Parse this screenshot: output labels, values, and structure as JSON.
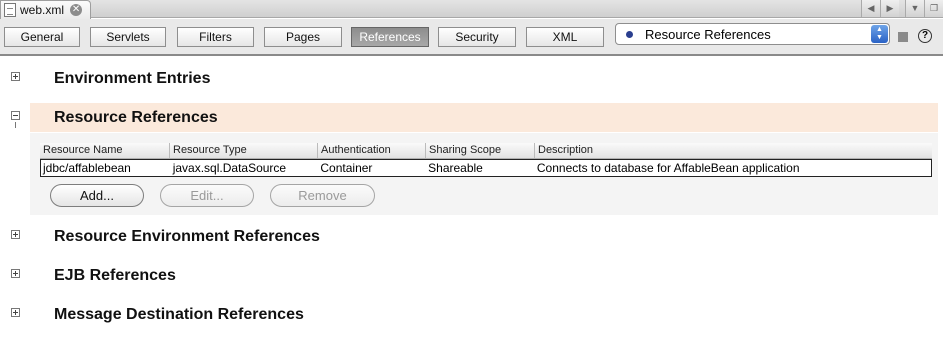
{
  "tab": {
    "filename": "web.xml"
  },
  "views": [
    {
      "label": "General",
      "active": false
    },
    {
      "label": "Servlets",
      "active": false
    },
    {
      "label": "Filters",
      "active": false
    },
    {
      "label": "Pages",
      "active": false
    },
    {
      "label": "References",
      "active": true
    },
    {
      "label": "Security",
      "active": false
    },
    {
      "label": "XML",
      "active": false
    }
  ],
  "combo": {
    "selected": "Resource References"
  },
  "sections": [
    {
      "title": "Environment Entries",
      "expanded": false
    },
    {
      "title": "Resource References",
      "expanded": true
    },
    {
      "title": "Resource Environment References",
      "expanded": false
    },
    {
      "title": "EJB References",
      "expanded": false
    },
    {
      "title": "Message Destination References",
      "expanded": false
    }
  ],
  "resource_table": {
    "columns": [
      "Resource Name",
      "Resource Type",
      "Authentication",
      "Sharing Scope",
      "Description"
    ],
    "rows": [
      [
        "jdbc/affablebean",
        "javax.sql.DataSource",
        "Container",
        "Shareable",
        "Connects to database for AffableBean application"
      ]
    ]
  },
  "buttons": {
    "add": "Add...",
    "edit": "Edit...",
    "remove": "Remove"
  },
  "icons": {
    "tab_file": "file-icon",
    "close": "close-icon",
    "stop": "stop-icon",
    "help": "help-icon"
  }
}
